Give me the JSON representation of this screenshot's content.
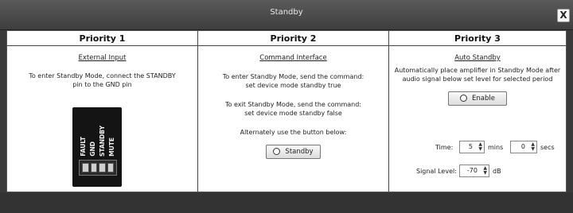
{
  "window": {
    "title": "Standby",
    "close_label": "X"
  },
  "columns": [
    {
      "header": "Priority 1",
      "section_title": "External Input",
      "description": "To enter Standby Mode, connect the STANDBY pin to the GND pin",
      "pins": [
        "FAULT",
        "GND",
        "STANDBY",
        "MUTE"
      ]
    },
    {
      "header": "Priority 2",
      "section_title": "Command Interface",
      "enter_text": "To enter Standby Mode, send the command:",
      "enter_cmd": "set device mode standby true",
      "exit_text": "To exit Standby Mode, send the command:",
      "exit_cmd": "set device mode standby false",
      "alt_text": "Alternately use the button below:",
      "button_label": "Standby"
    },
    {
      "header": "Priority 3",
      "section_title": "Auto Standby",
      "description": "Automatically place amplifier in Standby Mode after audio signal below set level for selected period",
      "enable_label": "Enable",
      "time_label": "Time:",
      "mins_value": "5",
      "mins_unit": "mins",
      "secs_value": "0",
      "secs_unit": "secs",
      "signal_label": "Signal Level:",
      "signal_value": "-70",
      "signal_unit": "dB"
    }
  ]
}
